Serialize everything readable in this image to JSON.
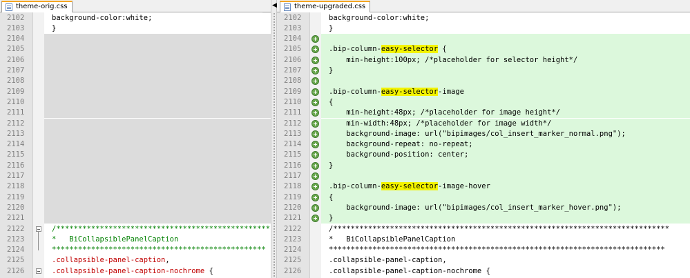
{
  "left_pane": {
    "tab_label": "theme-orig.css",
    "lines": [
      {
        "num": "2102",
        "bg": "white",
        "parts": [
          {
            "t": "background-color:white;"
          }
        ]
      },
      {
        "num": "2103",
        "bg": "white",
        "parts": [
          {
            "t": "}"
          }
        ]
      },
      {
        "num": "2104",
        "bg": "gray",
        "parts": []
      },
      {
        "num": "2105",
        "bg": "gray",
        "parts": []
      },
      {
        "num": "2106",
        "bg": "gray",
        "parts": []
      },
      {
        "num": "2107",
        "bg": "gray",
        "parts": []
      },
      {
        "num": "2108",
        "bg": "gray",
        "parts": []
      },
      {
        "num": "2109",
        "bg": "gray",
        "parts": []
      },
      {
        "num": "2110",
        "bg": "gray",
        "parts": []
      },
      {
        "num": "2111",
        "bg": "gray",
        "parts": []
      },
      {
        "num": "2112",
        "bg": "gray",
        "parts": []
      },
      {
        "num": "2113",
        "bg": "gray",
        "parts": []
      },
      {
        "num": "2114",
        "bg": "gray",
        "parts": []
      },
      {
        "num": "2115",
        "bg": "gray",
        "parts": []
      },
      {
        "num": "2116",
        "bg": "gray",
        "parts": []
      },
      {
        "num": "2117",
        "bg": "gray",
        "parts": []
      },
      {
        "num": "2118",
        "bg": "gray",
        "parts": []
      },
      {
        "num": "2119",
        "bg": "gray",
        "parts": []
      },
      {
        "num": "2120",
        "bg": "gray",
        "parts": []
      },
      {
        "num": "2121",
        "bg": "gray",
        "parts": []
      },
      {
        "num": "2122",
        "bg": "white",
        "fold": "start",
        "parts": [
          {
            "t": "/*************************************************",
            "c": "green"
          }
        ]
      },
      {
        "num": "2123",
        "bg": "white",
        "fold": "mid",
        "parts": [
          {
            "t": "*   BiCollapsiblePanelCaption",
            "c": "green"
          }
        ]
      },
      {
        "num": "2124",
        "bg": "white",
        "fold": "end",
        "parts": [
          {
            "t": "*************************************************",
            "c": "green"
          }
        ]
      },
      {
        "num": "2125",
        "bg": "white",
        "parts": [
          {
            "t": ".collapsible-panel-caption",
            "c": "red"
          },
          {
            "t": ","
          }
        ]
      },
      {
        "num": "2126",
        "bg": "white",
        "fold": "start",
        "parts": [
          {
            "t": ".collapsible-panel-caption-nochrome",
            "c": "red"
          },
          {
            "t": " {"
          }
        ]
      }
    ]
  },
  "right_pane": {
    "tab_label": "theme-upgraded.css",
    "lines": [
      {
        "num": "2102",
        "bg": "white",
        "parts": [
          {
            "t": "background-color:white;"
          }
        ]
      },
      {
        "num": "2103",
        "bg": "white",
        "parts": [
          {
            "t": "}"
          }
        ]
      },
      {
        "num": "2104",
        "bg": "green",
        "added": true,
        "parts": []
      },
      {
        "num": "2105",
        "bg": "green",
        "added": true,
        "parts": [
          {
            "t": ".bip-column-"
          },
          {
            "t": "easy-selector",
            "hl": true
          },
          {
            "t": " {"
          }
        ]
      },
      {
        "num": "2106",
        "bg": "green",
        "added": true,
        "parts": [
          {
            "t": "    min-height:100px; /*placeholder for selector height*/"
          }
        ]
      },
      {
        "num": "2107",
        "bg": "green",
        "added": true,
        "parts": [
          {
            "t": "}"
          }
        ]
      },
      {
        "num": "2108",
        "bg": "green",
        "added": true,
        "parts": []
      },
      {
        "num": "2109",
        "bg": "green",
        "added": true,
        "parts": [
          {
            "t": ".bip-column-"
          },
          {
            "t": "easy-selector",
            "hl": true
          },
          {
            "t": "-image"
          }
        ]
      },
      {
        "num": "2110",
        "bg": "green",
        "added": true,
        "parts": [
          {
            "t": "{"
          }
        ]
      },
      {
        "num": "2111",
        "bg": "green",
        "added": true,
        "parts": [
          {
            "t": "    min-height:48px; /*placeholder for image height*/"
          }
        ]
      },
      {
        "num": "2112",
        "bg": "green",
        "added": true,
        "parts": [
          {
            "t": "    min-width:48px; /*placeholder for image width*/"
          }
        ]
      },
      {
        "num": "2113",
        "bg": "green",
        "added": true,
        "parts": [
          {
            "t": "    background-image: url(\"bipimages/col_insert_marker_normal.png\");"
          }
        ]
      },
      {
        "num": "2114",
        "bg": "green",
        "added": true,
        "parts": [
          {
            "t": "    background-repeat: no-repeat;"
          }
        ]
      },
      {
        "num": "2115",
        "bg": "green",
        "added": true,
        "parts": [
          {
            "t": "    background-position: center;"
          }
        ]
      },
      {
        "num": "2116",
        "bg": "green",
        "added": true,
        "parts": [
          {
            "t": "}"
          }
        ]
      },
      {
        "num": "2117",
        "bg": "green",
        "added": true,
        "parts": []
      },
      {
        "num": "2118",
        "bg": "green",
        "added": true,
        "parts": [
          {
            "t": ".bip-column-"
          },
          {
            "t": "easy-selector",
            "hl": true
          },
          {
            "t": "-image-hover"
          }
        ]
      },
      {
        "num": "2119",
        "bg": "green",
        "added": true,
        "parts": [
          {
            "t": "{"
          }
        ]
      },
      {
        "num": "2120",
        "bg": "green",
        "added": true,
        "parts": [
          {
            "t": "    background-image: url(\"bipimages/col_insert_marker_hover.png\");"
          }
        ]
      },
      {
        "num": "2121",
        "bg": "green",
        "added": true,
        "parts": [
          {
            "t": "}"
          }
        ]
      },
      {
        "num": "2122",
        "bg": "white",
        "parts": [
          {
            "t": "/*****************************************************************************"
          }
        ]
      },
      {
        "num": "2123",
        "bg": "white",
        "parts": [
          {
            "t": "*   BiCollapsiblePanelCaption"
          }
        ]
      },
      {
        "num": "2124",
        "bg": "white",
        "parts": [
          {
            "t": "*****************************************************************************"
          }
        ]
      },
      {
        "num": "2125",
        "bg": "white",
        "parts": [
          {
            "t": ".collapsible-panel-caption,"
          }
        ]
      },
      {
        "num": "2126",
        "bg": "white",
        "parts": [
          {
            "t": ".collapsible-panel-caption-nochrome {"
          }
        ]
      }
    ]
  },
  "colors": {
    "added_line": "#dcf8dc",
    "missing_line": "#dcdcdc",
    "highlight": "#f3f300",
    "comment": "#008000",
    "selector": "#c00000"
  },
  "icons": {
    "tab": "css-file-icon",
    "added": "plus-circle-icon",
    "fold": "fold-collapse-icon",
    "splitter": "arrow-left-icon"
  }
}
